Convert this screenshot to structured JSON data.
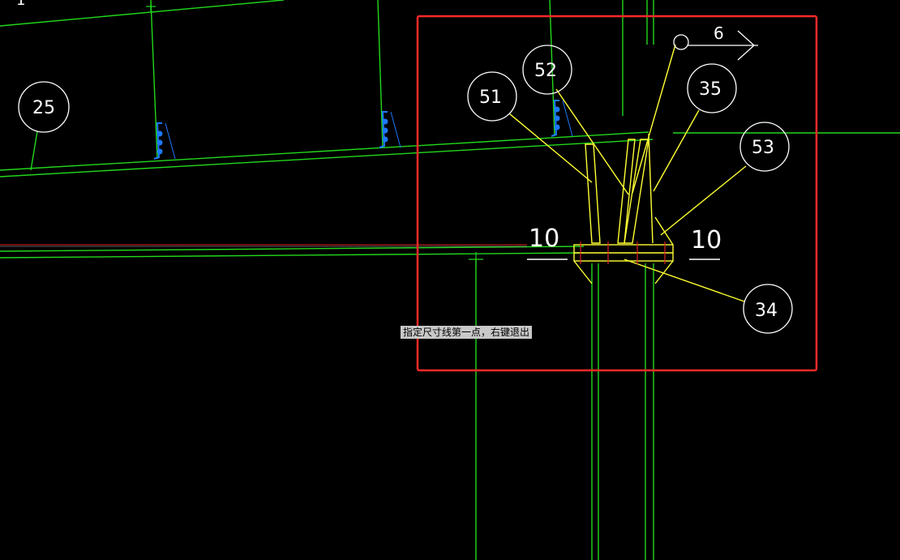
{
  "colors": {
    "background": "#000000",
    "line_green": "#22d81c",
    "line_yellow": "#ffff33",
    "line_red": "#e02020",
    "bolt_blue": "#1e78ff",
    "selection_red": "#ff2a2a",
    "text_white": "#ffffff"
  },
  "bubbles": {
    "b25": "25",
    "b51": "51",
    "b52": "52",
    "b35": "35",
    "b53": "53",
    "b34": "34"
  },
  "dimensions": {
    "left": "10",
    "right": "10"
  },
  "section_mark": {
    "label": "6"
  },
  "status_tooltip": {
    "text": "指定尺寸线第一点，右键退出"
  },
  "icons": {
    "cursor": "crosshair-cursor-icon",
    "bolt": "anchor-bolt-icon"
  }
}
